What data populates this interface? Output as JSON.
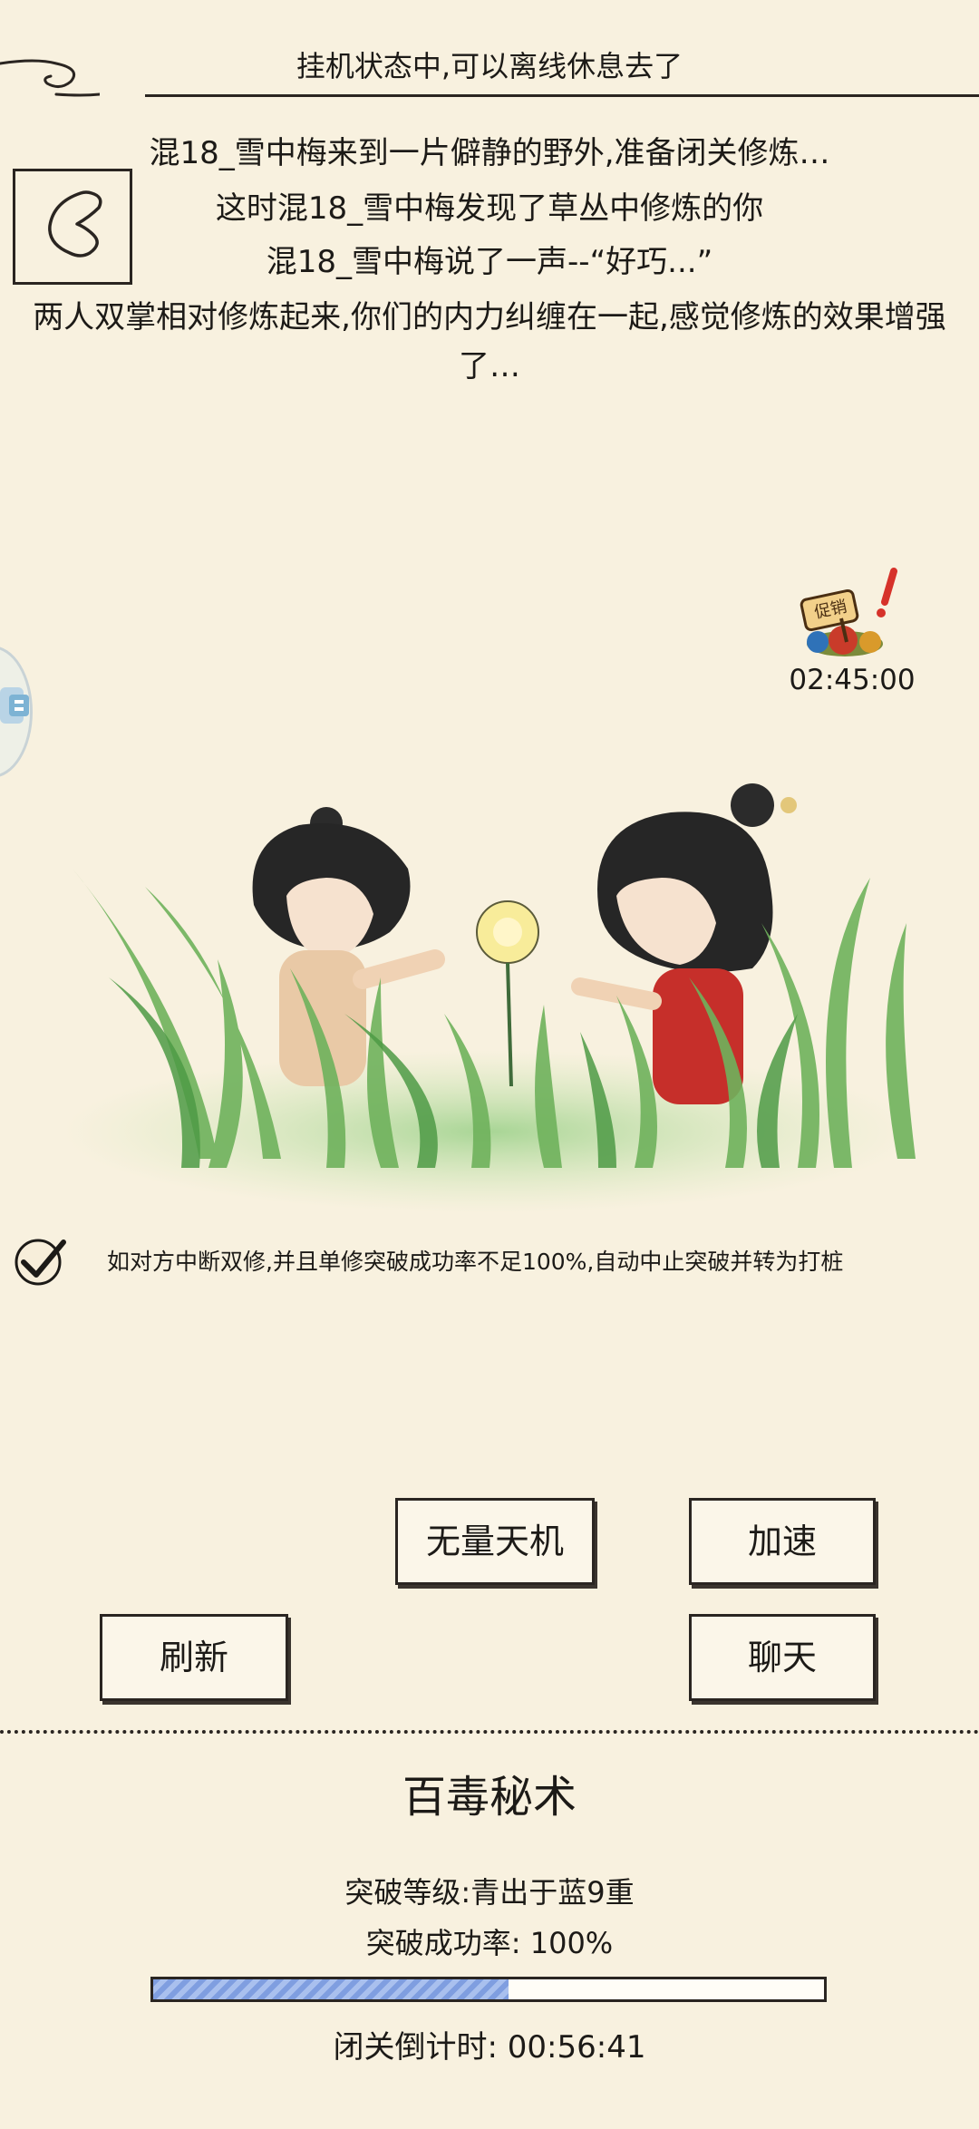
{
  "header": {
    "title": "挂机状态中,可以离线休息去了"
  },
  "story": {
    "line1": "混18_雪中梅来到一片僻静的野外,准备闭关修炼…",
    "line2": "这时混18_雪中梅发现了草丛中修炼的你",
    "line3": "混18_雪中梅说了一声--“好巧...”",
    "line4": "两人双掌相对修炼起来,你们的内力纠缠在一起,感觉修炼的效果增强了…"
  },
  "promo": {
    "badge": "促销",
    "timer": "02:45:00",
    "icon": "promo-bag-icon"
  },
  "checkbox": {
    "checked": true,
    "label": "如对方中断双修,并且单修突破成功率不足100%,自动中止突破并转为打桩"
  },
  "buttons": {
    "wuliang": "无量天机",
    "speed": "加速",
    "refresh": "刷新",
    "chat": "聊天"
  },
  "skill": {
    "name": "百毒秘术",
    "level": "突破等级:青出于蓝9重",
    "rate": "突破成功率: 100%",
    "progress": 0.53,
    "countdown": "闭关倒计时: 00:56:41"
  },
  "colors": {
    "background": "#f8f1df",
    "progress": "#8fa9e6",
    "ink": "#2a2521"
  }
}
